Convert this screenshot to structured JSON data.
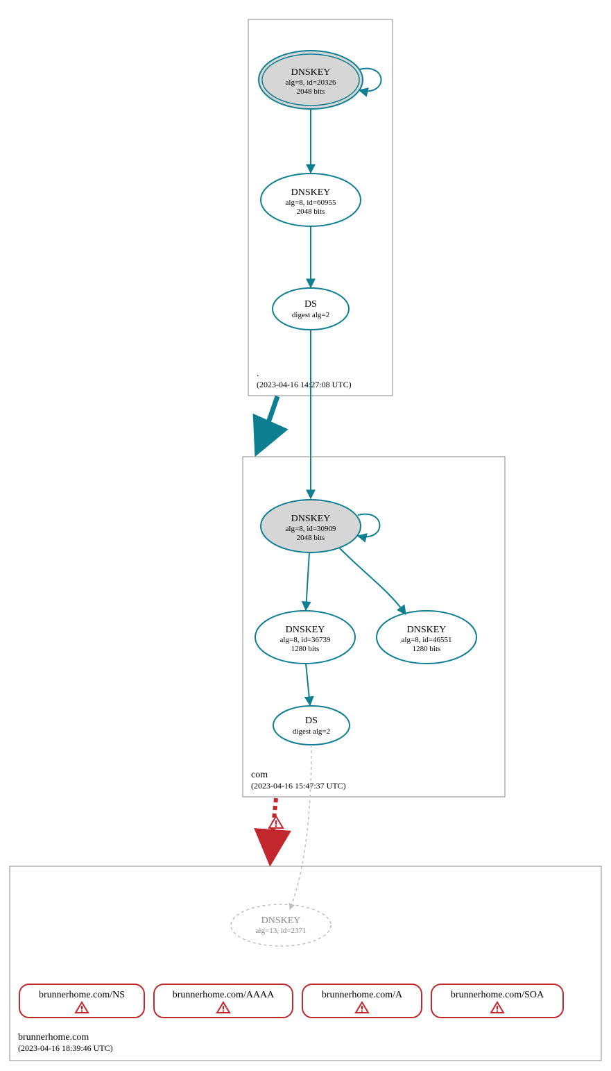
{
  "zones": {
    "root": {
      "label": ".",
      "timestamp": "(2023-04-16 14:27:08 UTC)",
      "nodes": {
        "ksk": {
          "title": "DNSKEY",
          "line1": "alg=8, id=20326",
          "line2": "2048 bits"
        },
        "zsk": {
          "title": "DNSKEY",
          "line1": "alg=8, id=60955",
          "line2": "2048 bits"
        },
        "ds": {
          "title": "DS",
          "line1": "digest alg=2"
        }
      }
    },
    "com": {
      "label": "com",
      "timestamp": "(2023-04-16 15:47:37 UTC)",
      "nodes": {
        "ksk": {
          "title": "DNSKEY",
          "line1": "alg=8, id=30909",
          "line2": "2048 bits"
        },
        "zsk1": {
          "title": "DNSKEY",
          "line1": "alg=8, id=36739",
          "line2": "1280 bits"
        },
        "zsk2": {
          "title": "DNSKEY",
          "line1": "alg=8, id=46551",
          "line2": "1280 bits"
        },
        "ds": {
          "title": "DS",
          "line1": "digest alg=2"
        }
      }
    },
    "domain": {
      "label": "brunnerhome.com",
      "timestamp": "(2023-04-16 18:39:46 UTC)",
      "nodes": {
        "key": {
          "title": "DNSKEY",
          "line1": "alg=13, id=2371"
        }
      },
      "records": {
        "ns": "brunnerhome.com/NS",
        "aaaa": "brunnerhome.com/AAAA",
        "a": "brunnerhome.com/A",
        "soa": "brunnerhome.com/SOA"
      }
    }
  },
  "colors": {
    "teal": "#0d7f91",
    "red": "#c1272d",
    "grey": "#bfbfbf"
  }
}
